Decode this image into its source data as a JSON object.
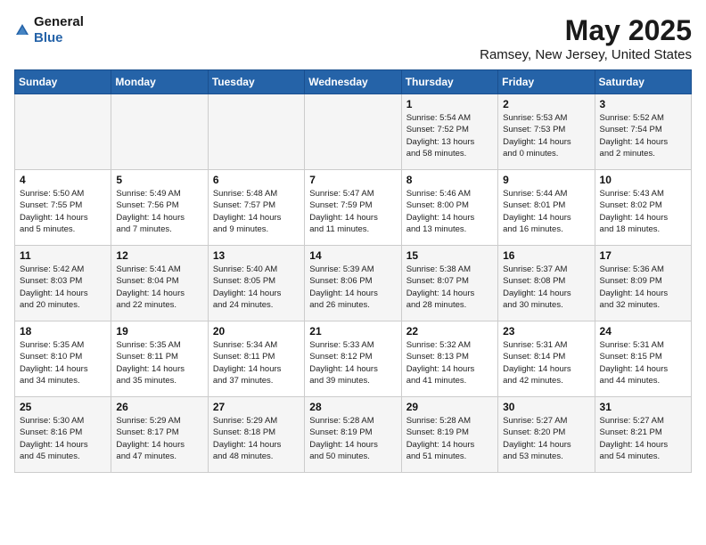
{
  "logo": {
    "general": "General",
    "blue": "Blue"
  },
  "title": "May 2025",
  "subtitle": "Ramsey, New Jersey, United States",
  "weekdays": [
    "Sunday",
    "Monday",
    "Tuesday",
    "Wednesday",
    "Thursday",
    "Friday",
    "Saturday"
  ],
  "weeks": [
    [
      {
        "day": "",
        "info": ""
      },
      {
        "day": "",
        "info": ""
      },
      {
        "day": "",
        "info": ""
      },
      {
        "day": "",
        "info": ""
      },
      {
        "day": "1",
        "info": "Sunrise: 5:54 AM\nSunset: 7:52 PM\nDaylight: 13 hours\nand 58 minutes."
      },
      {
        "day": "2",
        "info": "Sunrise: 5:53 AM\nSunset: 7:53 PM\nDaylight: 14 hours\nand 0 minutes."
      },
      {
        "day": "3",
        "info": "Sunrise: 5:52 AM\nSunset: 7:54 PM\nDaylight: 14 hours\nand 2 minutes."
      }
    ],
    [
      {
        "day": "4",
        "info": "Sunrise: 5:50 AM\nSunset: 7:55 PM\nDaylight: 14 hours\nand 5 minutes."
      },
      {
        "day": "5",
        "info": "Sunrise: 5:49 AM\nSunset: 7:56 PM\nDaylight: 14 hours\nand 7 minutes."
      },
      {
        "day": "6",
        "info": "Sunrise: 5:48 AM\nSunset: 7:57 PM\nDaylight: 14 hours\nand 9 minutes."
      },
      {
        "day": "7",
        "info": "Sunrise: 5:47 AM\nSunset: 7:59 PM\nDaylight: 14 hours\nand 11 minutes."
      },
      {
        "day": "8",
        "info": "Sunrise: 5:46 AM\nSunset: 8:00 PM\nDaylight: 14 hours\nand 13 minutes."
      },
      {
        "day": "9",
        "info": "Sunrise: 5:44 AM\nSunset: 8:01 PM\nDaylight: 14 hours\nand 16 minutes."
      },
      {
        "day": "10",
        "info": "Sunrise: 5:43 AM\nSunset: 8:02 PM\nDaylight: 14 hours\nand 18 minutes."
      }
    ],
    [
      {
        "day": "11",
        "info": "Sunrise: 5:42 AM\nSunset: 8:03 PM\nDaylight: 14 hours\nand 20 minutes."
      },
      {
        "day": "12",
        "info": "Sunrise: 5:41 AM\nSunset: 8:04 PM\nDaylight: 14 hours\nand 22 minutes."
      },
      {
        "day": "13",
        "info": "Sunrise: 5:40 AM\nSunset: 8:05 PM\nDaylight: 14 hours\nand 24 minutes."
      },
      {
        "day": "14",
        "info": "Sunrise: 5:39 AM\nSunset: 8:06 PM\nDaylight: 14 hours\nand 26 minutes."
      },
      {
        "day": "15",
        "info": "Sunrise: 5:38 AM\nSunset: 8:07 PM\nDaylight: 14 hours\nand 28 minutes."
      },
      {
        "day": "16",
        "info": "Sunrise: 5:37 AM\nSunset: 8:08 PM\nDaylight: 14 hours\nand 30 minutes."
      },
      {
        "day": "17",
        "info": "Sunrise: 5:36 AM\nSunset: 8:09 PM\nDaylight: 14 hours\nand 32 minutes."
      }
    ],
    [
      {
        "day": "18",
        "info": "Sunrise: 5:35 AM\nSunset: 8:10 PM\nDaylight: 14 hours\nand 34 minutes."
      },
      {
        "day": "19",
        "info": "Sunrise: 5:35 AM\nSunset: 8:11 PM\nDaylight: 14 hours\nand 35 minutes."
      },
      {
        "day": "20",
        "info": "Sunrise: 5:34 AM\nSunset: 8:11 PM\nDaylight: 14 hours\nand 37 minutes."
      },
      {
        "day": "21",
        "info": "Sunrise: 5:33 AM\nSunset: 8:12 PM\nDaylight: 14 hours\nand 39 minutes."
      },
      {
        "day": "22",
        "info": "Sunrise: 5:32 AM\nSunset: 8:13 PM\nDaylight: 14 hours\nand 41 minutes."
      },
      {
        "day": "23",
        "info": "Sunrise: 5:31 AM\nSunset: 8:14 PM\nDaylight: 14 hours\nand 42 minutes."
      },
      {
        "day": "24",
        "info": "Sunrise: 5:31 AM\nSunset: 8:15 PM\nDaylight: 14 hours\nand 44 minutes."
      }
    ],
    [
      {
        "day": "25",
        "info": "Sunrise: 5:30 AM\nSunset: 8:16 PM\nDaylight: 14 hours\nand 45 minutes."
      },
      {
        "day": "26",
        "info": "Sunrise: 5:29 AM\nSunset: 8:17 PM\nDaylight: 14 hours\nand 47 minutes."
      },
      {
        "day": "27",
        "info": "Sunrise: 5:29 AM\nSunset: 8:18 PM\nDaylight: 14 hours\nand 48 minutes."
      },
      {
        "day": "28",
        "info": "Sunrise: 5:28 AM\nSunset: 8:19 PM\nDaylight: 14 hours\nand 50 minutes."
      },
      {
        "day": "29",
        "info": "Sunrise: 5:28 AM\nSunset: 8:19 PM\nDaylight: 14 hours\nand 51 minutes."
      },
      {
        "day": "30",
        "info": "Sunrise: 5:27 AM\nSunset: 8:20 PM\nDaylight: 14 hours\nand 53 minutes."
      },
      {
        "day": "31",
        "info": "Sunrise: 5:27 AM\nSunset: 8:21 PM\nDaylight: 14 hours\nand 54 minutes."
      }
    ]
  ]
}
